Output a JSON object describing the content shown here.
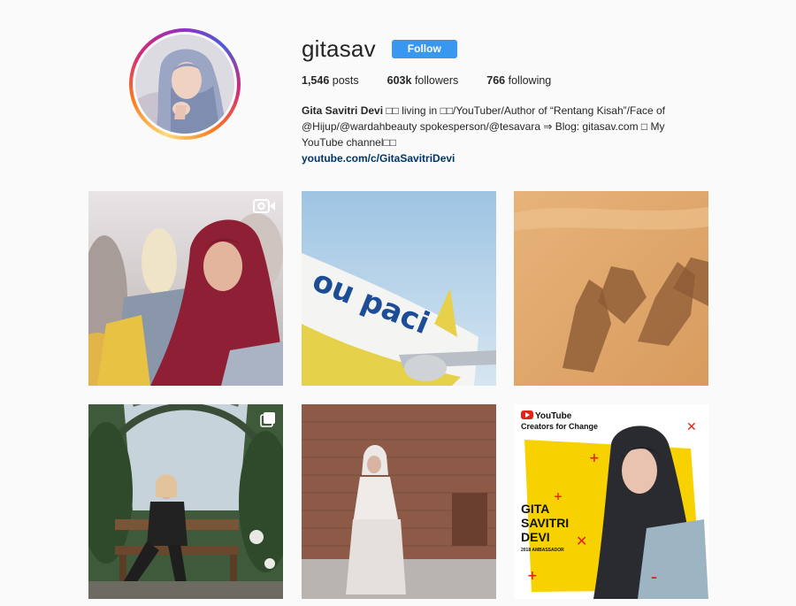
{
  "profile": {
    "username": "gitasav",
    "follow_label": "Follow",
    "stats": {
      "posts_count": "1,546",
      "posts_label": "posts",
      "followers_count": "603k",
      "followers_label": "followers",
      "following_count": "766",
      "following_label": "following"
    },
    "bio": {
      "full_name": "Gita Savitri Devi",
      "line1": " □□ living in □□/YouTuber/Author of “Rentang Kisah”/Face of",
      "line2": "@Hijup/@wardahbeauty spokesperson/@tesavara ⇒ Blog: gitasav.com □ My",
      "line3": "YouTube channel□□",
      "link": "youtube.com/c/GitaSavitriDevi"
    }
  },
  "posts": [
    {
      "alt": "hijab woman in crowd",
      "badge": "video-icon"
    },
    {
      "alt": "cebu pacific airplane"
    },
    {
      "alt": "camel shadows on desert sand"
    },
    {
      "alt": "woman sitting on garden bench",
      "badge": "multiple-photos-icon"
    },
    {
      "alt": "woman standing by brick wall"
    },
    {
      "alt": "youtube creators for change ambassador card",
      "card": {
        "brand": "YouTube",
        "subtitle": "Creators for Change",
        "name_lines": [
          "GITA",
          "SAVITRI",
          "DEVI"
        ],
        "tag": "2018 AMBASSADOR"
      }
    }
  ],
  "colors": {
    "follow_button": "#3897f0",
    "link": "#003569",
    "background": "#fafafa",
    "ring": [
      "#feda75",
      "#fa7e1e",
      "#d62976",
      "#962fbf",
      "#4f5bd5"
    ]
  }
}
